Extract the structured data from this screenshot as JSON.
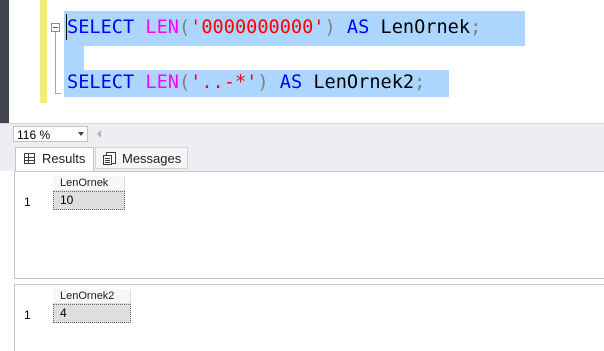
{
  "editor": {
    "line1": {
      "kw1": "SELECT",
      "fn": "LEN",
      "open": "(",
      "str": "'0000000000'",
      "close": ")",
      "kw2": "AS",
      "alias": "LenOrnek",
      "end": ";"
    },
    "line2": {
      "kw1": "SELECT",
      "fn": "LEN",
      "open": "(",
      "str": "'..-*'",
      "close": ")",
      "kw2": "AS",
      "alias": "LenOrnek2",
      "end": ";"
    }
  },
  "zoom": {
    "value": "116 %"
  },
  "tabs": {
    "results": "Results",
    "messages": "Messages"
  },
  "results": [
    {
      "column": "LenOrnek",
      "row_number": "1",
      "value": "10"
    },
    {
      "column": "LenOrnek2",
      "row_number": "1",
      "value": "4"
    }
  ],
  "icons": {
    "results_tab": "grid-icon",
    "messages_tab": "messages-icon",
    "collapse": "collapse-minus-icon"
  }
}
